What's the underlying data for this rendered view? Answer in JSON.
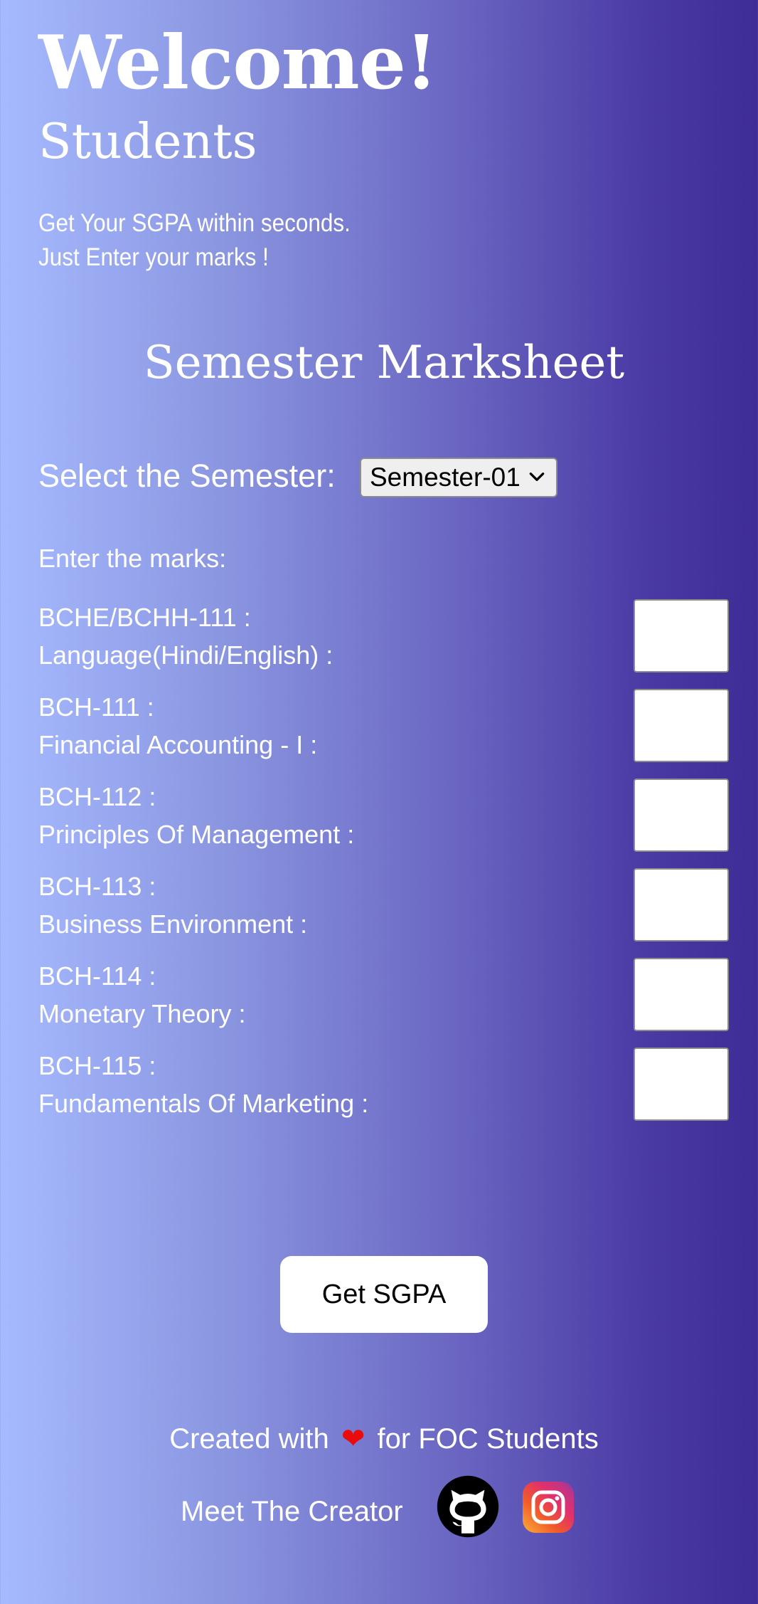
{
  "header": {
    "welcome": "Welcome!",
    "students": "Students",
    "tagline_line1": "Get Your SGPA within seconds.",
    "tagline_line2": "Just Enter your marks !"
  },
  "marksheet": {
    "title": "Semester Marksheet",
    "select_label": "Select the Semester:",
    "selected_semester": "Semester-01",
    "enter_marks_label": "Enter the marks:",
    "subjects": [
      {
        "code": "BCHE/BCHH-111 :",
        "name": "Language(Hindi/English) :",
        "value": ""
      },
      {
        "code": "BCH-111 :",
        "name": "Financial Accounting - I :",
        "value": ""
      },
      {
        "code": "BCH-112 :",
        "name": "Principles Of Management :",
        "value": ""
      },
      {
        "code": "BCH-113 :",
        "name": "Business Environment :",
        "value": ""
      },
      {
        "code": "BCH-114 :",
        "name": "Monetary Theory :",
        "value": ""
      },
      {
        "code": "BCH-115 :",
        "name": "Fundamentals Of Marketing :",
        "value": ""
      }
    ],
    "submit_label": "Get SGPA"
  },
  "footer": {
    "created_prefix": "Created with",
    "heart": "❤",
    "created_suffix": "for FOC Students",
    "meet_label": "Meet The Creator",
    "icons": [
      "github-icon",
      "instagram-icon"
    ]
  },
  "colors": {
    "gradient_start": "#a6baff",
    "gradient_end": "#3f2c96",
    "heart": "#ea0b0b"
  }
}
